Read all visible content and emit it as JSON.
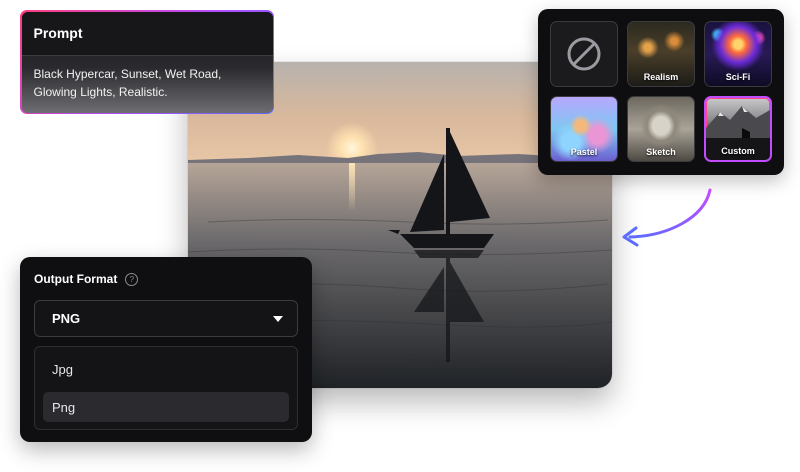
{
  "prompt": {
    "title": "Prompt",
    "text": "Black Hypercar, Sunset, Wet Road, Glowing Lights, Realistic."
  },
  "styles": {
    "items": [
      {
        "label": "",
        "icon": "no-style-icon"
      },
      {
        "label": "Realism"
      },
      {
        "label": "Sci-Fi"
      },
      {
        "label": "Pastel"
      },
      {
        "label": "Sketch"
      },
      {
        "label": "Custom",
        "selected": true
      }
    ],
    "accent": "#c24dff"
  },
  "output_format": {
    "title": "Output Format",
    "help_icon": "help-icon",
    "selected": "PNG",
    "options": [
      "Jpg",
      "Png"
    ],
    "highlighted_option": "Png"
  },
  "colors": {
    "card_bg": "#0f0f11",
    "arrow": "#5b6cff"
  }
}
